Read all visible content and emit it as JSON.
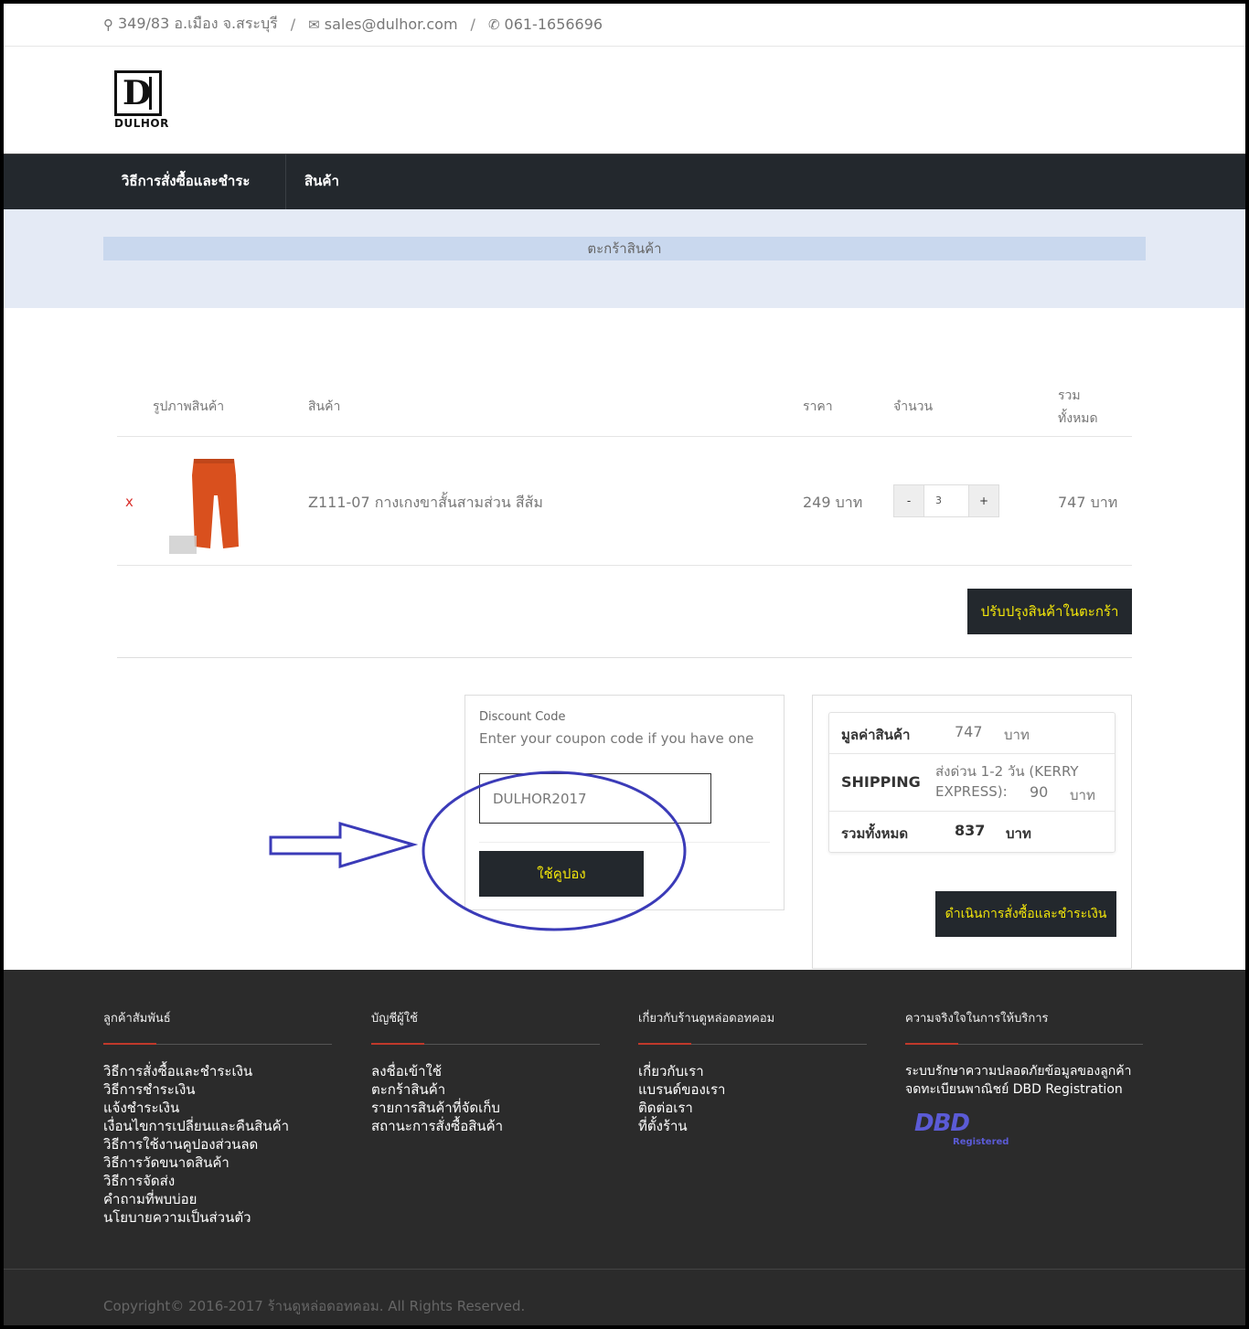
{
  "topbar": {
    "address": "349/83 อ.เมือง จ.สระบุรี",
    "email": "sales@dulhor.com",
    "phone": "061-1656696",
    "separator": "/"
  },
  "logo": {
    "letter": "D",
    "text": "DULHOR"
  },
  "nav": {
    "item1": "วิธีการสั่งซื้อและชำระเงิน",
    "item2": "สินค้า"
  },
  "banner": {
    "title": "ตะกร้าสินค้า"
  },
  "cart": {
    "headers": {
      "image": "รูปภาพสินค้า",
      "product": "สินค้า",
      "price": "ราคา",
      "qty": "จำนวน",
      "total_line1": "รวม",
      "total_line2": "ทั้งหมด"
    },
    "items": [
      {
        "remove": "x",
        "name": "Z111-07 กางเกงขาสั้นสามส่วน สีส้ม",
        "price": "249 บาท",
        "qty": "3",
        "minus": "-",
        "plus": "+",
        "total": "747 บาท",
        "image_color": "#d9501e"
      }
    ],
    "update_label": "ปรับปรุงสินค้าในตะกร้า"
  },
  "coupon": {
    "label": "Discount Code",
    "hint": "Enter your coupon code if you have one",
    "value": "DULHOR2017",
    "apply_label": "ใช้คูปอง"
  },
  "summary": {
    "subtotal_label": "มูลค่าสินค้า",
    "subtotal_value": "747",
    "subtotal_unit": "บาท",
    "shipping_label": "SHIPPING",
    "shipping_method_line1": "ส่งด่วน 1-2 วัน (KERRY",
    "shipping_method_line2": "EXPRESS):",
    "shipping_value": "90",
    "shipping_unit": "บาท",
    "total_label": "รวมทั้งหมด",
    "total_value": "837",
    "total_unit": "บาท",
    "checkout_label": "ดำเนินการสั่งซื้อและชำระเงิน"
  },
  "footer": {
    "col1": {
      "title": "ลูกค้าสัมพันธ์",
      "links": [
        "วิธีการสั่งซื้อและชำระเงิน",
        "วิธีการชำระเงิน",
        "แจ้งชำระเงิน",
        "เงื่อนไขการเปลี่ยนและคืนสินค้า",
        "วิธีการใช้งานคูปองส่วนลด",
        "วิธีการวัดขนาดสินค้า",
        "วิธีการจัดส่ง",
        "คำถามที่พบบ่อย",
        "นโยบายความเป็นส่วนตัว"
      ]
    },
    "col2": {
      "title": "บัญชีผู้ใช้",
      "links": [
        "ลงชื่อเข้าใช้",
        "ตะกร้าสินค้า",
        "รายการสินค้าที่จัดเก็บ",
        "สถานะการสั่งซื้อสินค้า"
      ]
    },
    "col3": {
      "title": "เกี่ยวกับร้านดูหล่อดอทคอม",
      "links": [
        "เกี่ยวกับเรา",
        "แบรนด์ของเรา",
        "ติดต่อเรา",
        "ที่ตั้งร้าน"
      ]
    },
    "col4": {
      "title": "ความจริงใจในการให้บริการ",
      "links": [
        "ระบบรักษาความปลอดภัยข้อมูลของลูกค้า",
        "จดทะเบียนพาณิชย์ DBD Registration"
      ],
      "badge_big": "DBD",
      "badge_small": "Registered"
    },
    "copyright": "Copyright© 2016-2017 ร้านดูหล่อดอทคอม. All Rights Reserved."
  },
  "colors": {
    "nav_bg": "#23282d",
    "button_text": "#f3e60a",
    "banner_bg": "#e4eaf5",
    "annotation": "#3b3bb8",
    "remove": "#d9302c"
  }
}
